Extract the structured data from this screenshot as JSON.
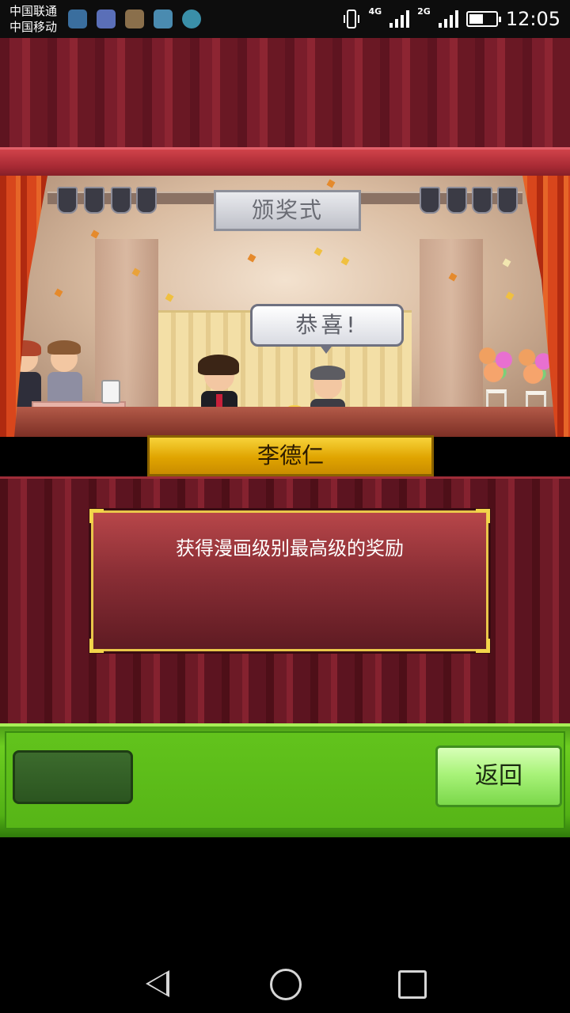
{
  "status_bar": {
    "carrier1": "中国联通",
    "carrier2": "中国移动",
    "network1": "4G",
    "network2": "2G",
    "time": "12:05",
    "battery_level": 0.55,
    "notification_icons": [
      "app-icon-1",
      "app-icon-2",
      "app-icon-3",
      "gallery-icon",
      "chat-icon"
    ]
  },
  "stage": {
    "sign_text": "颁奖式",
    "speech_bubble": "恭喜!"
  },
  "winner": {
    "name": "李德仁"
  },
  "award": {
    "description": "获得漫画级别最高级的奖励"
  },
  "actions": {
    "back_label": "返回"
  },
  "colors": {
    "accent_gold": "#e0a400",
    "button_green": "#a9f37a",
    "panel_red": "#8a2e35"
  }
}
